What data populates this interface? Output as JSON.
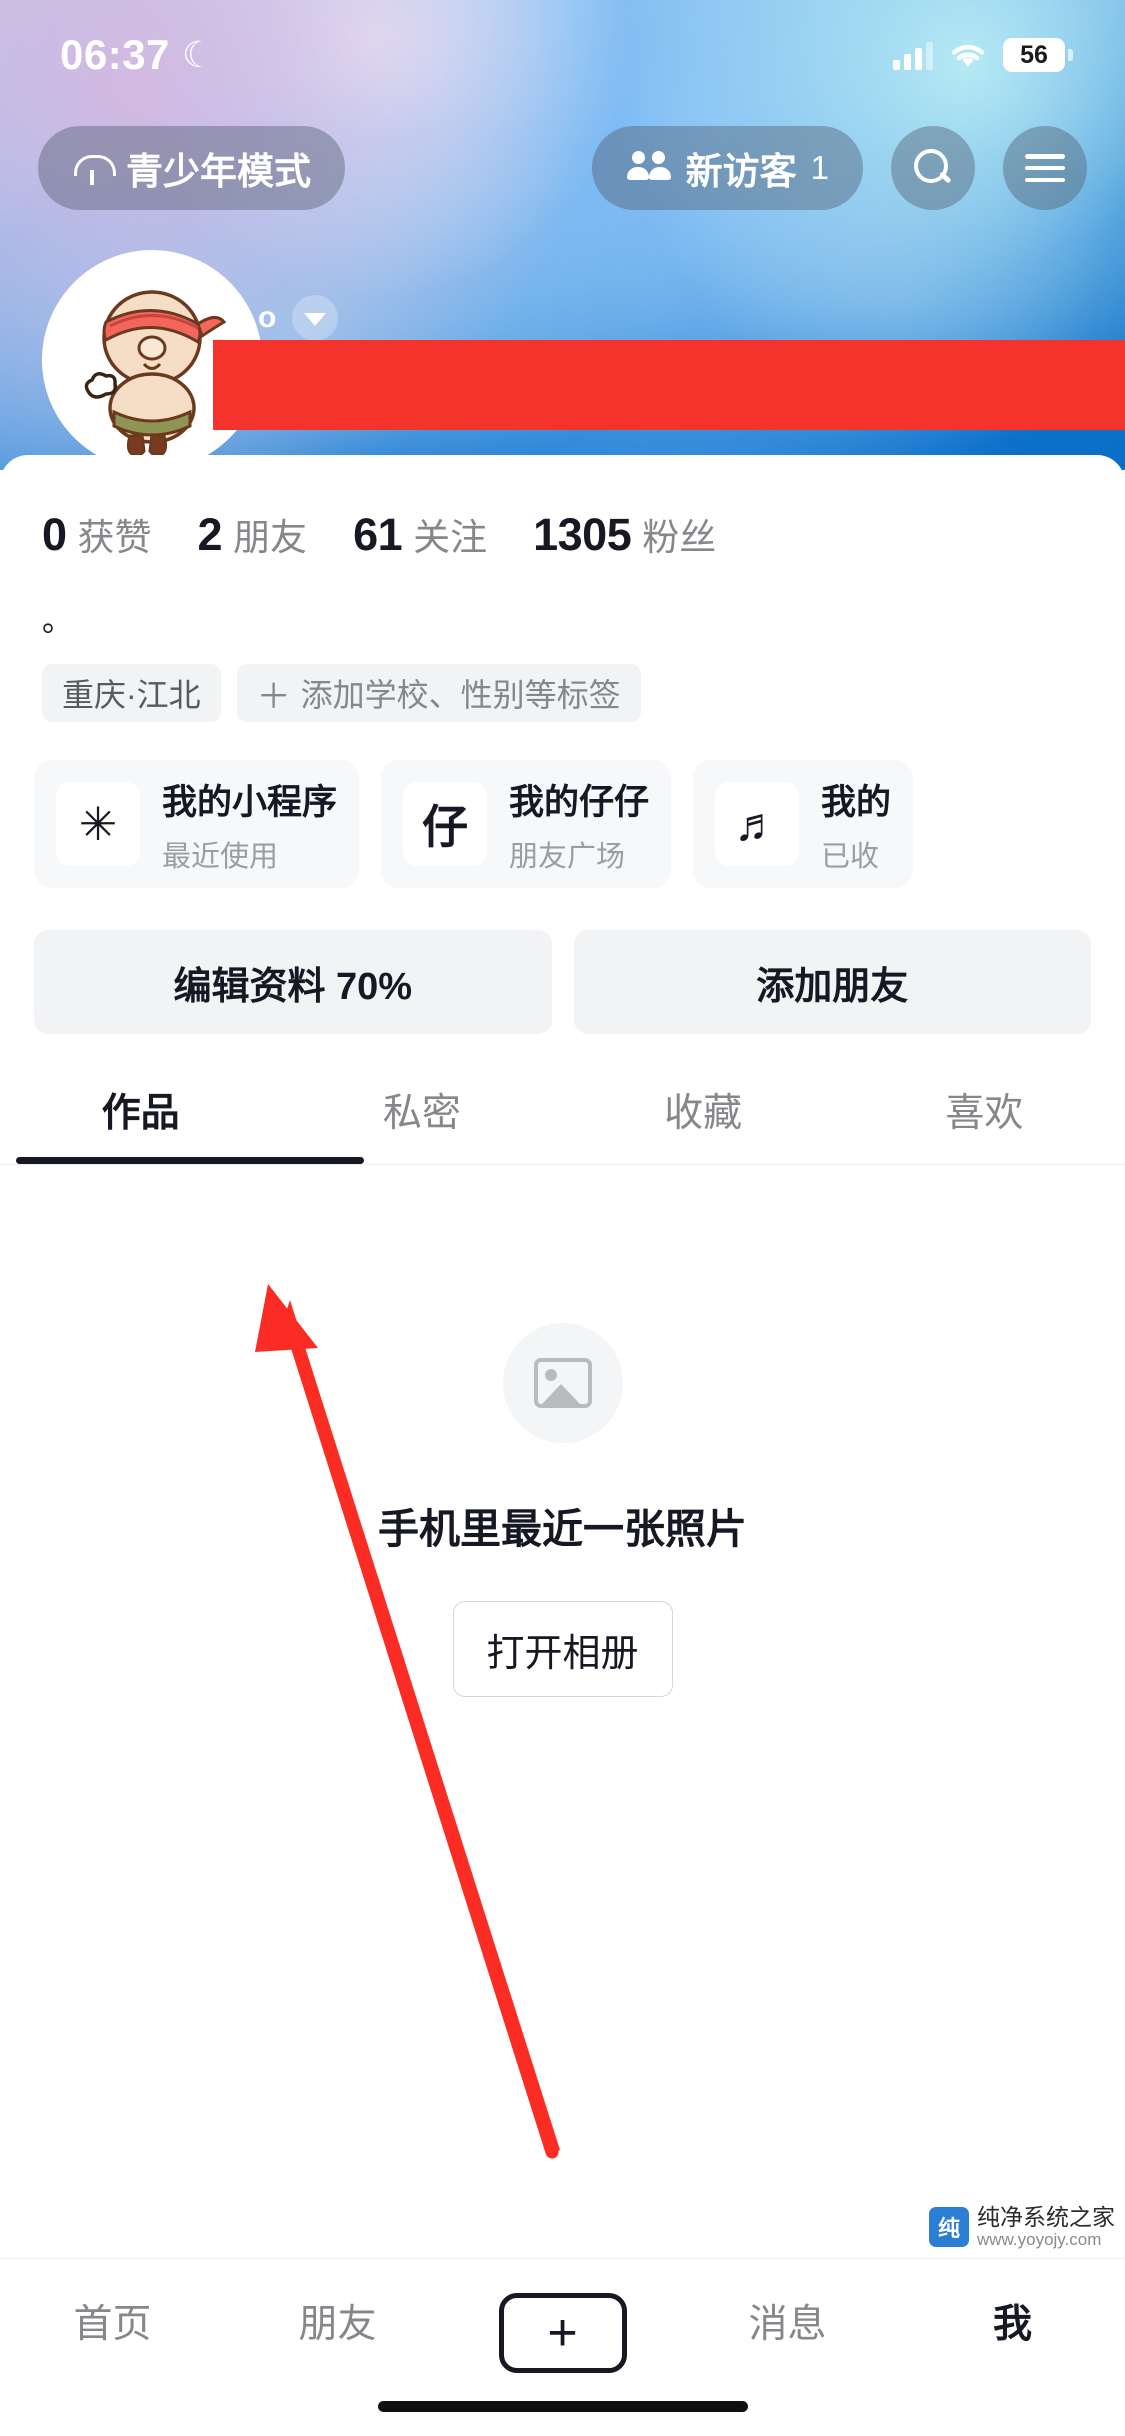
{
  "status_bar": {
    "time": "06:37",
    "dnd_icon": "moon-icon",
    "signal_icon": "cellular-signal-icon",
    "wifi_icon": "wifi-icon",
    "battery_level": "56"
  },
  "top_nav": {
    "teen_mode_label": "青少年模式",
    "teen_mode_icon": "umbrella-icon",
    "visitors_label": "新访客",
    "visitors_count": "1",
    "visitors_icon": "people-icon",
    "search_icon": "search-icon",
    "menu_icon": "hamburger-menu-icon"
  },
  "profile": {
    "avatar_icon": "cartoon-avatar",
    "name_dot": "o",
    "dropdown_icon": "chevron-down-icon",
    "redacted_name": ""
  },
  "stats": [
    {
      "num": "0",
      "label": "获赞"
    },
    {
      "num": "2",
      "label": "朋友"
    },
    {
      "num": "61",
      "label": "关注"
    },
    {
      "num": "1305",
      "label": "粉丝"
    }
  ],
  "bio": "。",
  "tags": [
    {
      "text": "重庆·江北",
      "plus": false
    },
    {
      "text": "添加学校、性别等标签",
      "plus": true,
      "plus_symbol": "＋"
    }
  ],
  "cards": [
    {
      "icon": "mini-program-icon",
      "glyph": "✳",
      "title": "我的小程序",
      "subtitle": "最近使用"
    },
    {
      "icon": "zaizai-icon",
      "glyph": "仔",
      "title": "我的仔仔",
      "subtitle": "朋友广场"
    },
    {
      "icon": "music-note-icon",
      "glyph": "♬",
      "title": "我的",
      "subtitle": "已收"
    }
  ],
  "actions": [
    {
      "label": "编辑资料 70%"
    },
    {
      "label": "添加朋友"
    }
  ],
  "tabs": [
    {
      "label": "作品",
      "active": true
    },
    {
      "label": "私密",
      "active": false
    },
    {
      "label": "收藏",
      "active": false
    },
    {
      "label": "喜欢",
      "active": false
    }
  ],
  "empty_state": {
    "icon": "photo-placeholder-icon",
    "title": "手机里最近一张照片",
    "button_label": "打开相册"
  },
  "bottom_nav": [
    {
      "label": "首页",
      "active": false
    },
    {
      "label": "朋友",
      "active": false
    },
    {
      "label": "+",
      "active": false,
      "is_plus": true
    },
    {
      "label": "消息",
      "active": false
    },
    {
      "label": "我",
      "active": true
    }
  ],
  "watermark": {
    "badge": "纯",
    "line1": "纯净系统之家",
    "line2": "www.yoyojy.com"
  },
  "colors": {
    "accent_red": "#f5332d",
    "text_primary": "#161823",
    "text_secondary": "#86878b",
    "chip_bg": "#f2f3f5",
    "cover_blue": "#0a6ec7"
  }
}
